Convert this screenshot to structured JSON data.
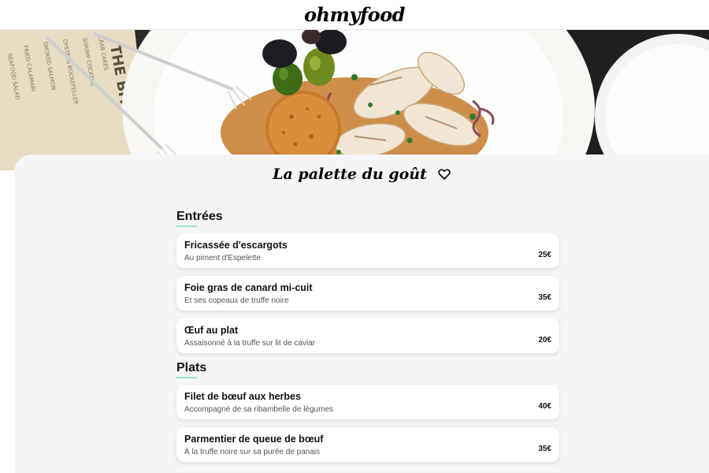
{
  "header": {
    "logo": "ohmyfood"
  },
  "restaurant": {
    "name": "La palette du goût"
  },
  "hero": {
    "menu_board_text": "THE BITE"
  },
  "sections": [
    {
      "title": "Entrées",
      "items": [
        {
          "name": "Fricassée d'escargots",
          "desc": "Au piment d'Espelette",
          "price": "25€"
        },
        {
          "name": "Foie gras de canard mi-cuit",
          "desc": "Et ses copeaux de truffe noire",
          "price": "35€"
        },
        {
          "name": "Œuf au plat",
          "desc": "Assaisonné à la truffe sur lit de caviar",
          "price": "20€"
        }
      ]
    },
    {
      "title": "Plats",
      "items": [
        {
          "name": "Filet de bœuf aux herbes",
          "desc": "Accompagné de sa ribambelle de légumes",
          "price": "40€"
        },
        {
          "name": "Parmentier de queue de bœuf",
          "desc": "À la truffe noire sur sa purée de panais",
          "price": "35€"
        }
      ]
    }
  ],
  "colors": {
    "accent": "#99e2d0",
    "sheet_bg": "#f5f5f5"
  },
  "icons": {
    "favorite": "heart-icon"
  }
}
